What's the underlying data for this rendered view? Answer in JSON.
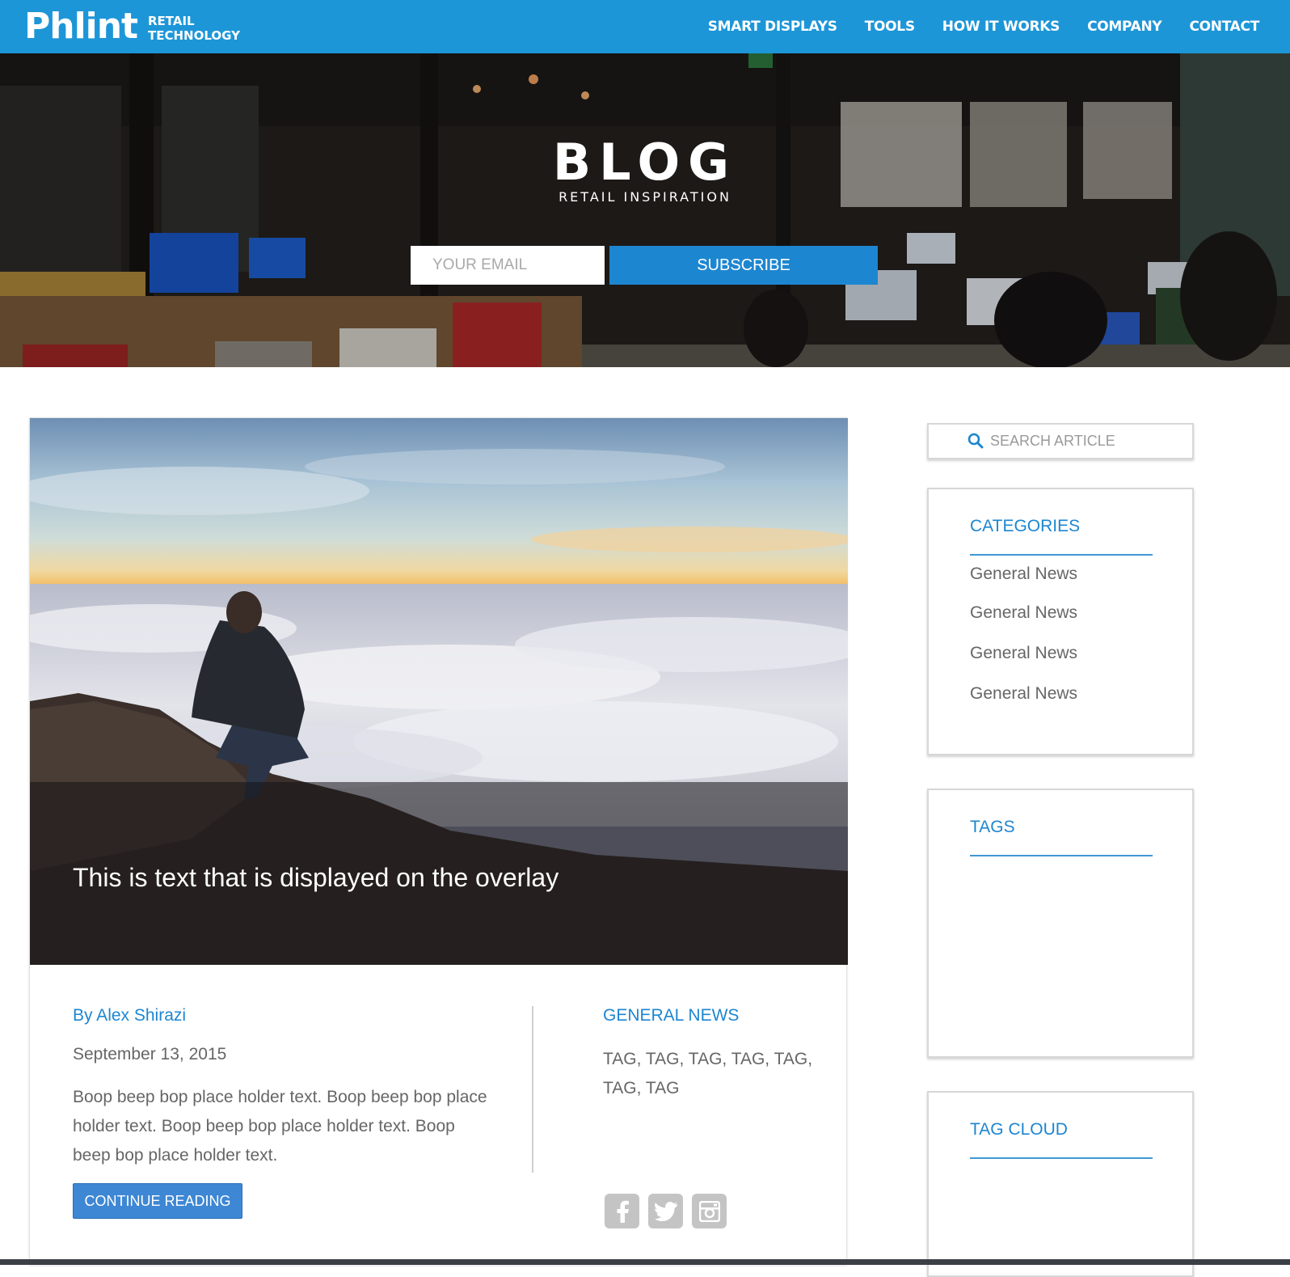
{
  "nav": {
    "logo": "Phlint",
    "logo_sub_line1": "RETAIL",
    "logo_sub_line2": "TECHNOLOGY",
    "items": [
      "SMART DISPLAYS",
      "TOOLS",
      "HOW IT WORKS",
      "COMPANY",
      "CONTACT"
    ]
  },
  "hero": {
    "title": "BLOG",
    "subtitle": "RETAIL INSPIRATION",
    "email_placeholder": "YOUR EMAIL",
    "subscribe_label": "SUBSCRIBE"
  },
  "post": {
    "overlay_text": "This is text that is displayed on the overlay",
    "author": "By Alex Shirazi",
    "date": "September 13, 2015",
    "excerpt": "Boop beep bop place holder text. Boop beep bop place holder text. Boop beep bop place holder text. Boop beep bop place holder text.",
    "continue_label": "CONTINUE READING",
    "category": "GENERAL NEWS",
    "tags": "TAG, TAG, TAG, TAG, TAG, TAG, TAG",
    "social_icons": [
      "facebook-icon",
      "twitter-icon",
      "instagram-icon"
    ]
  },
  "sidebar": {
    "search_placeholder": "SEARCH ARTICLE",
    "categories_title": "CATEGORIES",
    "categories": [
      "General News",
      "General News",
      "General News",
      "General News"
    ],
    "tags_title": "TAGS",
    "tag_cloud_title": "TAG CLOUD"
  },
  "colors": {
    "brand_blue": "#1d96d8",
    "accent_blue": "#1d86d0",
    "button_blue": "#3d87d4"
  }
}
